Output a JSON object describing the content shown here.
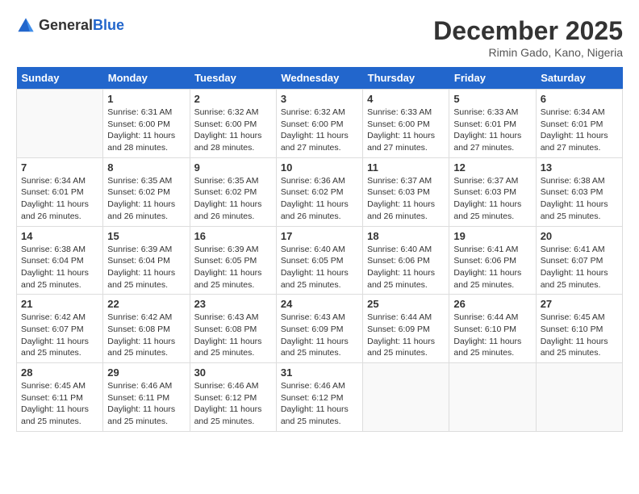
{
  "header": {
    "logo_general": "General",
    "logo_blue": "Blue",
    "month": "December 2025",
    "location": "Rimin Gado, Kano, Nigeria"
  },
  "weekdays": [
    "Sunday",
    "Monday",
    "Tuesday",
    "Wednesday",
    "Thursday",
    "Friday",
    "Saturday"
  ],
  "weeks": [
    [
      {
        "day": "",
        "info": ""
      },
      {
        "day": "1",
        "info": "Sunrise: 6:31 AM\nSunset: 6:00 PM\nDaylight: 11 hours and 28 minutes."
      },
      {
        "day": "2",
        "info": "Sunrise: 6:32 AM\nSunset: 6:00 PM\nDaylight: 11 hours and 28 minutes."
      },
      {
        "day": "3",
        "info": "Sunrise: 6:32 AM\nSunset: 6:00 PM\nDaylight: 11 hours and 27 minutes."
      },
      {
        "day": "4",
        "info": "Sunrise: 6:33 AM\nSunset: 6:00 PM\nDaylight: 11 hours and 27 minutes."
      },
      {
        "day": "5",
        "info": "Sunrise: 6:33 AM\nSunset: 6:01 PM\nDaylight: 11 hours and 27 minutes."
      },
      {
        "day": "6",
        "info": "Sunrise: 6:34 AM\nSunset: 6:01 PM\nDaylight: 11 hours and 27 minutes."
      }
    ],
    [
      {
        "day": "7",
        "info": "Sunrise: 6:34 AM\nSunset: 6:01 PM\nDaylight: 11 hours and 26 minutes."
      },
      {
        "day": "8",
        "info": "Sunrise: 6:35 AM\nSunset: 6:02 PM\nDaylight: 11 hours and 26 minutes."
      },
      {
        "day": "9",
        "info": "Sunrise: 6:35 AM\nSunset: 6:02 PM\nDaylight: 11 hours and 26 minutes."
      },
      {
        "day": "10",
        "info": "Sunrise: 6:36 AM\nSunset: 6:02 PM\nDaylight: 11 hours and 26 minutes."
      },
      {
        "day": "11",
        "info": "Sunrise: 6:37 AM\nSunset: 6:03 PM\nDaylight: 11 hours and 26 minutes."
      },
      {
        "day": "12",
        "info": "Sunrise: 6:37 AM\nSunset: 6:03 PM\nDaylight: 11 hours and 25 minutes."
      },
      {
        "day": "13",
        "info": "Sunrise: 6:38 AM\nSunset: 6:03 PM\nDaylight: 11 hours and 25 minutes."
      }
    ],
    [
      {
        "day": "14",
        "info": "Sunrise: 6:38 AM\nSunset: 6:04 PM\nDaylight: 11 hours and 25 minutes."
      },
      {
        "day": "15",
        "info": "Sunrise: 6:39 AM\nSunset: 6:04 PM\nDaylight: 11 hours and 25 minutes."
      },
      {
        "day": "16",
        "info": "Sunrise: 6:39 AM\nSunset: 6:05 PM\nDaylight: 11 hours and 25 minutes."
      },
      {
        "day": "17",
        "info": "Sunrise: 6:40 AM\nSunset: 6:05 PM\nDaylight: 11 hours and 25 minutes."
      },
      {
        "day": "18",
        "info": "Sunrise: 6:40 AM\nSunset: 6:06 PM\nDaylight: 11 hours and 25 minutes."
      },
      {
        "day": "19",
        "info": "Sunrise: 6:41 AM\nSunset: 6:06 PM\nDaylight: 11 hours and 25 minutes."
      },
      {
        "day": "20",
        "info": "Sunrise: 6:41 AM\nSunset: 6:07 PM\nDaylight: 11 hours and 25 minutes."
      }
    ],
    [
      {
        "day": "21",
        "info": "Sunrise: 6:42 AM\nSunset: 6:07 PM\nDaylight: 11 hours and 25 minutes."
      },
      {
        "day": "22",
        "info": "Sunrise: 6:42 AM\nSunset: 6:08 PM\nDaylight: 11 hours and 25 minutes."
      },
      {
        "day": "23",
        "info": "Sunrise: 6:43 AM\nSunset: 6:08 PM\nDaylight: 11 hours and 25 minutes."
      },
      {
        "day": "24",
        "info": "Sunrise: 6:43 AM\nSunset: 6:09 PM\nDaylight: 11 hours and 25 minutes."
      },
      {
        "day": "25",
        "info": "Sunrise: 6:44 AM\nSunset: 6:09 PM\nDaylight: 11 hours and 25 minutes."
      },
      {
        "day": "26",
        "info": "Sunrise: 6:44 AM\nSunset: 6:10 PM\nDaylight: 11 hours and 25 minutes."
      },
      {
        "day": "27",
        "info": "Sunrise: 6:45 AM\nSunset: 6:10 PM\nDaylight: 11 hours and 25 minutes."
      }
    ],
    [
      {
        "day": "28",
        "info": "Sunrise: 6:45 AM\nSunset: 6:11 PM\nDaylight: 11 hours and 25 minutes."
      },
      {
        "day": "29",
        "info": "Sunrise: 6:46 AM\nSunset: 6:11 PM\nDaylight: 11 hours and 25 minutes."
      },
      {
        "day": "30",
        "info": "Sunrise: 6:46 AM\nSunset: 6:12 PM\nDaylight: 11 hours and 25 minutes."
      },
      {
        "day": "31",
        "info": "Sunrise: 6:46 AM\nSunset: 6:12 PM\nDaylight: 11 hours and 25 minutes."
      },
      {
        "day": "",
        "info": ""
      },
      {
        "day": "",
        "info": ""
      },
      {
        "day": "",
        "info": ""
      }
    ]
  ]
}
